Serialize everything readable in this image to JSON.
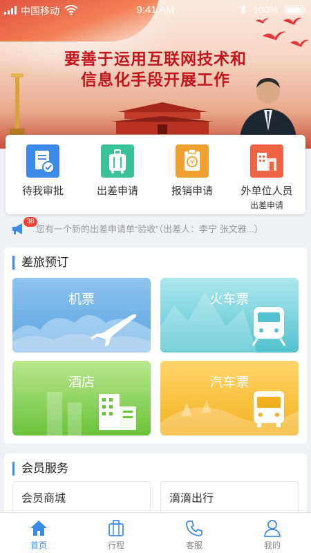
{
  "status_bar": {
    "carrier": "中国移动",
    "time": "9:41 AM",
    "battery": "100%"
  },
  "banner": {
    "line1": "要善于运用互联网技术和",
    "line2": "信息化手段开展工作"
  },
  "quick_actions": [
    {
      "label": "待我审批",
      "sub": "",
      "icon": "approval-icon",
      "color": "#3d8be8"
    },
    {
      "label": "出差申请",
      "sub": "",
      "icon": "luggage-icon",
      "color": "#3cc29a"
    },
    {
      "label": "报销申请",
      "sub": "",
      "icon": "reimburse-icon",
      "color": "#f0a030"
    },
    {
      "label": "外单位人员",
      "sub": "出差申请",
      "icon": "building-icon",
      "color": "#f06446"
    }
  ],
  "notice": {
    "badge": "38",
    "text": "您有一个新的出差申请单“验收”（出差人：李宁 张文雅...）"
  },
  "travel": {
    "title": "差旅预订",
    "tiles": {
      "flight": "机票",
      "train": "火车票",
      "hotel": "酒店",
      "bus": "汽车票"
    }
  },
  "member": {
    "title": "会员服务",
    "cards": [
      "会员商城",
      "滴滴出行"
    ]
  },
  "tabs": [
    {
      "label": "首页",
      "icon": "home-icon",
      "active": true
    },
    {
      "label": "行程",
      "icon": "trip-icon",
      "active": false
    },
    {
      "label": "客服",
      "icon": "phone-icon",
      "active": false
    },
    {
      "label": "我的",
      "icon": "user-icon",
      "active": false
    }
  ]
}
